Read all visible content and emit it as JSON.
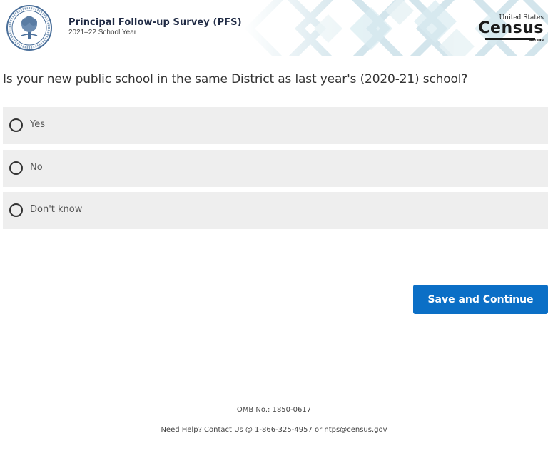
{
  "header": {
    "survey_title": "Principal Follow-up Survey (PFS)",
    "survey_subtitle": "2021–22 School Year",
    "seal_icon": "department-of-education-seal",
    "census_logo": {
      "top_text": "United States",
      "main_text": "Census",
      "bottom_text": "Bureau"
    }
  },
  "question": {
    "text": "Is your new public school in the same District as last year's (2020-21) school?"
  },
  "options": [
    {
      "label": "Yes"
    },
    {
      "label": "No"
    },
    {
      "label": "Don't know"
    }
  ],
  "actions": {
    "save_label": "Save and Continue"
  },
  "footer": {
    "omb": "OMB No.: 1850-0617",
    "help": "Need Help? Contact Us @ 1-866-325-4957 or ntps@census.gov"
  },
  "colors": {
    "primary_button": "#0b6fc6",
    "option_background": "#eeeeee",
    "text": "#333333"
  }
}
